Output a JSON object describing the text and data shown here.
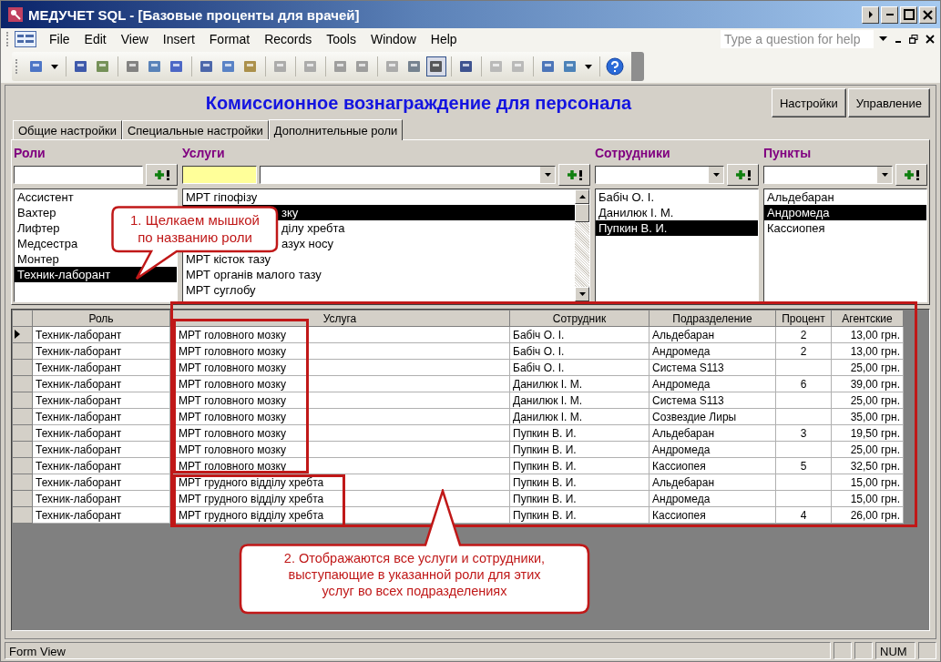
{
  "window": {
    "title": "МЕДУЧЕТ SQL - [Базовые проценты для врачей]"
  },
  "menu": [
    "File",
    "Edit",
    "View",
    "Insert",
    "Format",
    "Records",
    "Tools",
    "Window",
    "Help"
  ],
  "help_box": {
    "placeholder": "Type a question for help"
  },
  "form": {
    "title": "Комиссионное вознаграждение для персонала",
    "buttons": [
      "Настройки",
      "Управление"
    ],
    "tabs": [
      {
        "label": "Общие настройки",
        "selected": false
      },
      {
        "label": "Специальные настройки",
        "selected": false
      },
      {
        "label": "Дополнительные роли",
        "selected": true
      }
    ]
  },
  "roles": {
    "label": "Роли",
    "items": [
      {
        "text": "Ассистент",
        "selected": false
      },
      {
        "text": "Вахтер",
        "selected": false
      },
      {
        "text": "Лифтер",
        "selected": false
      },
      {
        "text": "Медсестра",
        "selected": false
      },
      {
        "text": "Монтер",
        "selected": false
      },
      {
        "text": "Техник-лаборант",
        "selected": true
      }
    ]
  },
  "services": {
    "label": "Услуги",
    "items": [
      {
        "text": "МРТ гіпофізу",
        "selected": false,
        "kind": "full"
      },
      {
        "text": "зку",
        "selected": true,
        "kind": "partial"
      },
      {
        "text": "ділу хребта",
        "selected": false,
        "kind": "partial"
      },
      {
        "text": "азух носу",
        "selected": false,
        "kind": "partial"
      },
      {
        "text": "МРТ кісток тазу",
        "selected": false,
        "kind": "full"
      },
      {
        "text": "МРТ органів малого тазу",
        "selected": false,
        "kind": "full"
      },
      {
        "text": "МРТ суглобу",
        "selected": false,
        "kind": "full"
      }
    ]
  },
  "employees": {
    "label": "Сотрудники",
    "items": [
      {
        "text": "Бабіч О. І.",
        "selected": false
      },
      {
        "text": "Данилюк І. М.",
        "selected": false
      },
      {
        "text": "Пупкин В. И.",
        "selected": true
      }
    ]
  },
  "points": {
    "label": "Пункты",
    "items": [
      {
        "text": "Альдебаран",
        "selected": false
      },
      {
        "text": "Андромеда",
        "selected": true
      },
      {
        "text": "Кассиопея",
        "selected": false
      }
    ]
  },
  "table": {
    "columns": [
      "Роль",
      "Услуга",
      "Сотрудник",
      "Подразделение",
      "Процент",
      "Агентские"
    ],
    "rows": [
      {
        "current": true,
        "cells": [
          "Техник-лаборант",
          "МРТ головного мозку",
          "Бабіч О. І.",
          "Альдебаран",
          "2",
          "13,00 грн."
        ]
      },
      {
        "current": false,
        "cells": [
          "Техник-лаборант",
          "МРТ головного мозку",
          "Бабіч О. І.",
          "Андромеда",
          "2",
          "13,00 грн."
        ]
      },
      {
        "current": false,
        "cells": [
          "Техник-лаборант",
          "МРТ головного мозку",
          "Бабіч О. І.",
          "Система S113",
          "",
          "25,00 грн."
        ]
      },
      {
        "current": false,
        "cells": [
          "Техник-лаборант",
          "МРТ головного мозку",
          "Данилюк І. М.",
          "Андромеда",
          "6",
          "39,00 грн."
        ]
      },
      {
        "current": false,
        "cells": [
          "Техник-лаборант",
          "МРТ головного мозку",
          "Данилюк І. М.",
          "Система S113",
          "",
          "25,00 грн."
        ]
      },
      {
        "current": false,
        "cells": [
          "Техник-лаборант",
          "МРТ головного мозку",
          "Данилюк І. М.",
          "Созвездие Лиры",
          "",
          "35,00 грн."
        ]
      },
      {
        "current": false,
        "cells": [
          "Техник-лаборант",
          "МРТ головного мозку",
          "Пупкин В. И.",
          "Альдебаран",
          "3",
          "19,50 грн."
        ]
      },
      {
        "current": false,
        "cells": [
          "Техник-лаборант",
          "МРТ головного мозку",
          "Пупкин В. И.",
          "Андромеда",
          "",
          "25,00 грн."
        ]
      },
      {
        "current": false,
        "cells": [
          "Техник-лаборант",
          "МРТ головного мозку",
          "Пупкин В. И.",
          "Кассиопея",
          "5",
          "32,50 грн."
        ]
      },
      {
        "current": false,
        "cells": [
          "Техник-лаборант",
          "МРТ грудного відділу хребта",
          "Пупкин В. И.",
          "Альдебаран",
          "",
          "15,00 грн."
        ]
      },
      {
        "current": false,
        "cells": [
          "Техник-лаборант",
          "МРТ грудного відділу хребта",
          "Пупкин В. И.",
          "Андромеда",
          "",
          "15,00 грн."
        ]
      },
      {
        "current": false,
        "cells": [
          "Техник-лаборант",
          "МРТ грудного відділу хребта",
          "Пупкин В. И.",
          "Кассиопея",
          "4",
          "26,00 грн."
        ]
      }
    ]
  },
  "callouts": [
    {
      "text": "1. Щелкаем мышкой\nпо названию роли"
    },
    {
      "text": "2. Отображаются все услуги и сотрудники,\nвыступающие в указанной роли для этих\nуслуг во всех подразделениях"
    }
  ],
  "status_bar": {
    "mode": "Form View",
    "keys": "NUM"
  }
}
